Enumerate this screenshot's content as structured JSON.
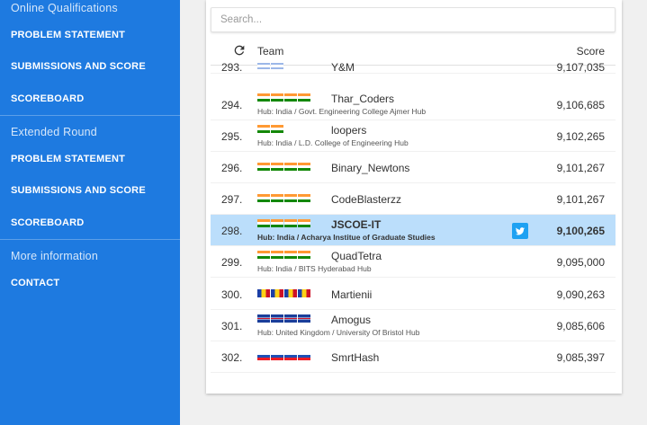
{
  "sidebar": {
    "section1": "Online Qualifications",
    "section1_items": [
      "PROBLEM STATEMENT",
      "SUBMISSIONS AND SCORE",
      "SCOREBOARD"
    ],
    "section2": "Extended Round",
    "section2_items": [
      "PROBLEM STATEMENT",
      "SUBMISSIONS AND SCORE",
      "SCOREBOARD"
    ],
    "section3": "More information",
    "section3_items": [
      "CONTACT"
    ]
  },
  "search": {
    "placeholder": "Search..."
  },
  "table": {
    "team_header": "Team",
    "score_header": "Score",
    "rows": [
      {
        "rank": "293.",
        "flag": "israel",
        "flag_count": 2,
        "team": "Y&M",
        "hub": "",
        "score": "9,107,035"
      },
      {
        "rank": "294.",
        "flag": "india",
        "flag_count": 4,
        "team": "Thar_Coders",
        "hub": "Hub: India / Govt. Engineering College Ajmer Hub",
        "score": "9,106,685"
      },
      {
        "rank": "295.",
        "flag": "india",
        "flag_count": 2,
        "team": "loopers",
        "hub": "Hub: India / L.D. College of Engineering Hub",
        "score": "9,102,265"
      },
      {
        "rank": "296.",
        "flag": "india",
        "flag_count": 4,
        "team": "Binary_Newtons",
        "hub": "",
        "score": "9,101,267"
      },
      {
        "rank": "297.",
        "flag": "india",
        "flag_count": 4,
        "team": "CodeBlasterzz",
        "hub": "",
        "score": "9,101,267"
      },
      {
        "rank": "298.",
        "flag": "india",
        "flag_count": 4,
        "team": "JSCOE-IT",
        "hub": "Hub: India / Acharya Institue of Graduate Studies",
        "score": "9,100,265",
        "highlight": true,
        "twitter_icon": "twitter-icon"
      },
      {
        "rank": "299.",
        "flag": "india",
        "flag_count": 4,
        "team": "QuadTetra",
        "hub": "Hub: India / BITS Hyderabad Hub",
        "score": "9,095,000"
      },
      {
        "rank": "300.",
        "flag": "romania",
        "flag_count": 4,
        "team": "Martienii",
        "hub": "",
        "score": "9,090,263"
      },
      {
        "rank": "301.",
        "flag": "united-kingdom",
        "flag_count": 4,
        "team": "Amogus",
        "hub": "Hub: United Kingdom / University Of Bristol Hub",
        "score": "9,085,606"
      },
      {
        "rank": "302.",
        "flag": "slovakia",
        "flag_count": 4,
        "team": "SmrtHash",
        "hub": "",
        "score": "9,085,397"
      }
    ]
  },
  "colors": {
    "sidebar": "#1e7ae0",
    "highlight_row": "#bbdefb",
    "twitter": "#1da1f2"
  },
  "icons": {
    "refresh": "refresh-icon",
    "twitter": "twitter-icon"
  }
}
